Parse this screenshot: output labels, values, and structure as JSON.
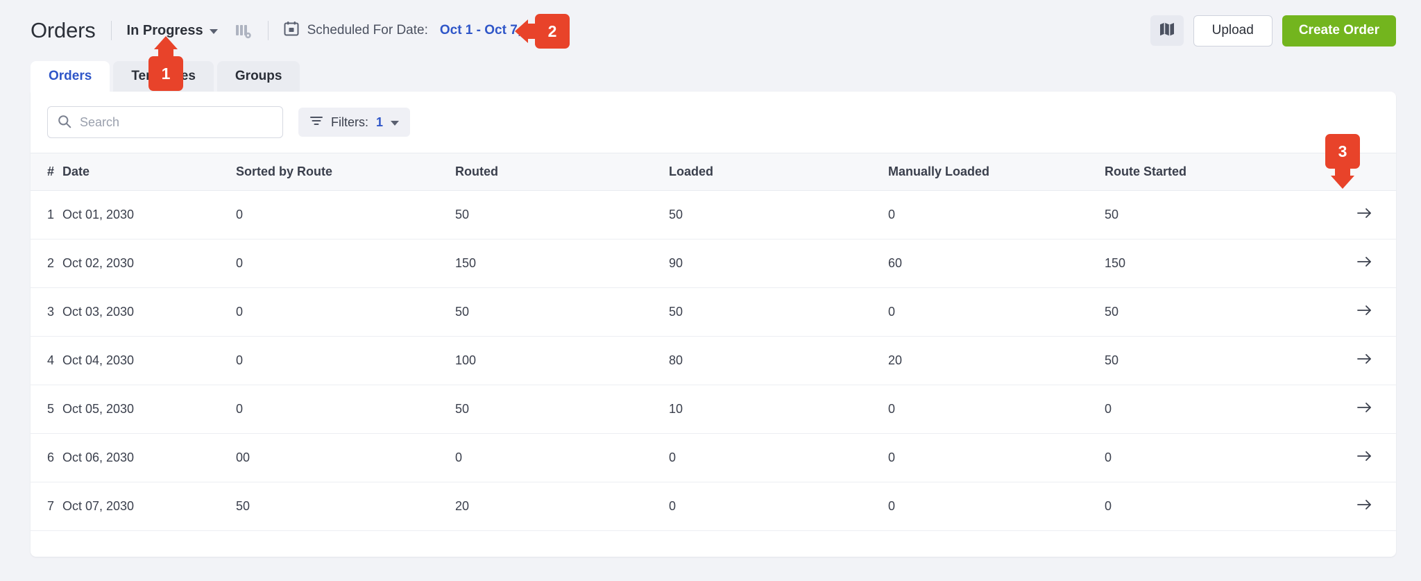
{
  "header": {
    "title": "Orders",
    "status_filter": {
      "label": "In Progress",
      "icon": "chevron-down-icon"
    },
    "columns_icon": "columns-settings-icon",
    "calendar_icon": "calendar-icon",
    "schedule_label": "Scheduled For Date:",
    "schedule_value": "Oct 1 - Oct 7, 2030",
    "map_icon": "map-icon",
    "upload_label": "Upload",
    "create_order_label": "Create Order",
    "accent_link": "#2f56c8",
    "accent_green": "#73b51e"
  },
  "tabs": [
    {
      "label": "Orders",
      "active": true
    },
    {
      "label": "Territories",
      "active": false
    },
    {
      "label": "Groups",
      "active": false
    }
  ],
  "toolbar": {
    "search_placeholder": "Search",
    "search_value": "",
    "search_icon": "search-icon",
    "filters_icon": "filter-icon",
    "filters_label": "Filters:",
    "filters_count": "1",
    "filters_caret": "chevron-down-icon"
  },
  "table": {
    "columns": [
      "#",
      "Date",
      "Sorted by Route",
      "Routed",
      "Loaded",
      "Manually Loaded",
      "Route Started",
      ""
    ],
    "row_action_icon": "arrow-right-icon",
    "rows": [
      {
        "num": "1",
        "date": "Oct 01, 2030",
        "sorted_by_route": "0",
        "routed": "50",
        "loaded": "50",
        "manually_loaded": "0",
        "route_started": "50"
      },
      {
        "num": "2",
        "date": "Oct 02, 2030",
        "sorted_by_route": "0",
        "routed": "150",
        "loaded": "90",
        "manually_loaded": "60",
        "route_started": "150"
      },
      {
        "num": "3",
        "date": "Oct 03, 2030",
        "sorted_by_route": "0",
        "routed": "50",
        "loaded": "50",
        "manually_loaded": "0",
        "route_started": "50"
      },
      {
        "num": "4",
        "date": "Oct 04, 2030",
        "sorted_by_route": "0",
        "routed": "100",
        "loaded": "80",
        "manually_loaded": "20",
        "route_started": "50"
      },
      {
        "num": "5",
        "date": "Oct 05, 2030",
        "sorted_by_route": "0",
        "routed": "50",
        "loaded": "10",
        "manually_loaded": "0",
        "route_started": "0"
      },
      {
        "num": "6",
        "date": "Oct 06, 2030",
        "sorted_by_route": "00",
        "routed": "0",
        "loaded": "0",
        "manually_loaded": "0",
        "route_started": "0"
      },
      {
        "num": "7",
        "date": "Oct 07, 2030",
        "sorted_by_route": "50",
        "routed": "20",
        "loaded": "0",
        "manually_loaded": "0",
        "route_started": "0"
      }
    ]
  },
  "annotations": [
    {
      "id": "1",
      "label": "1",
      "direction": "up",
      "target": "status-filter"
    },
    {
      "id": "2",
      "label": "2",
      "direction": "left",
      "target": "schedule-date-value"
    },
    {
      "id": "3",
      "label": "3",
      "direction": "down",
      "target": "row-action-arrow"
    }
  ]
}
